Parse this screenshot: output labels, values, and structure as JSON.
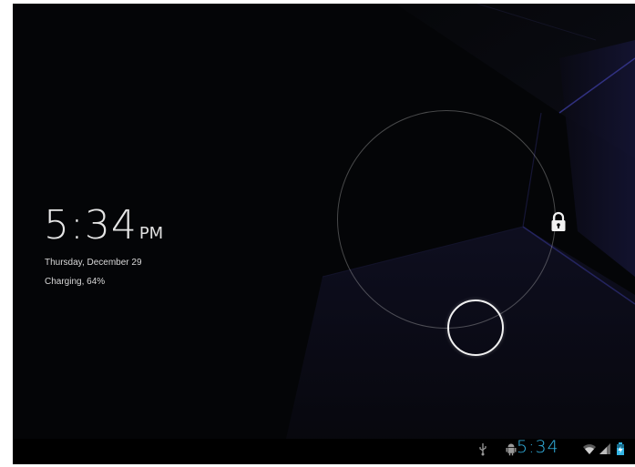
{
  "lockscreen": {
    "clock_time": "5:34",
    "clock_ampm": "PM",
    "date": "Thursday, December 29",
    "charging_status": "Charging, 64%"
  },
  "status_bar": {
    "time": "5:34",
    "icons": [
      "usb-icon",
      "android-debug-icon",
      "wifi-icon",
      "signal-icon",
      "battery-charging-icon"
    ],
    "accent_color": "#33b5e5"
  },
  "unlock": {
    "target_icon": "lock-icon"
  }
}
